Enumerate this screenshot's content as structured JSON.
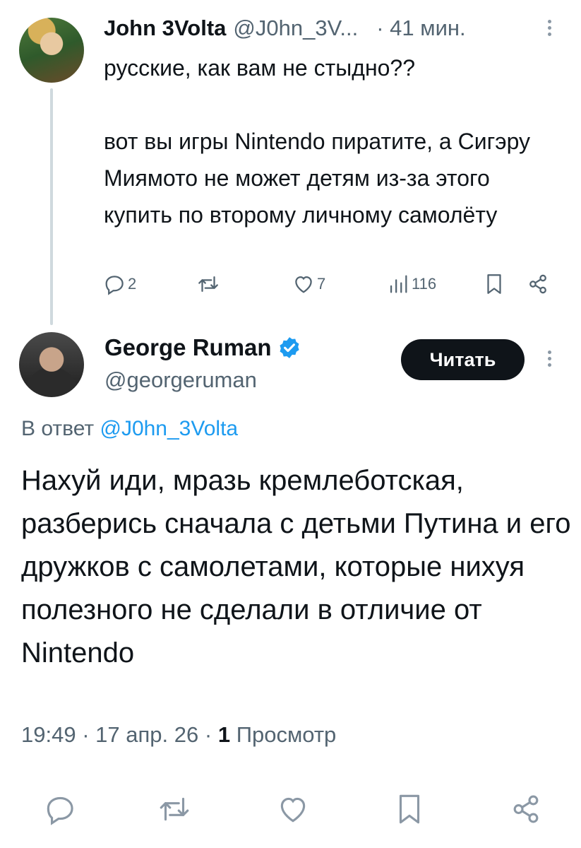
{
  "parent_tweet": {
    "display_name": "John 3Volta",
    "handle": "@J0hn_3V...",
    "time": "· 41 мин.",
    "text": "русские, как вам не стыдно??\n\nвот вы игры Nintendo пиратите, а Сигэру Миямото не может детям из-за этого купить по второму личному самолёту",
    "stats": {
      "replies": "2",
      "retweets": "",
      "likes": "7",
      "views": "116"
    }
  },
  "main_tweet": {
    "display_name": "George Ruman",
    "handle": "@georgeruman",
    "follow_label": "Читать",
    "reply_prefix": "В ответ",
    "reply_to": "@J0hn_3Volta",
    "text": "Нахуй иди, мразь кремлеботская, разберись сначала с детьми Путина и его дружков с самолетами, которые нихуя полезного не сделали в отличие от Nintendo",
    "time": "19:49",
    "date": "17 апр. 26",
    "views_count": "1",
    "views_label": "Просмотр"
  },
  "colors": {
    "text": "#0f1419",
    "secondary": "#536471",
    "link": "#1d9bf0",
    "verified": "#1d9bf0",
    "button": "#0f1419"
  },
  "icons": [
    "reply-icon",
    "retweet-icon",
    "like-icon",
    "views-icon",
    "bookmark-icon",
    "share-icon",
    "verified-icon",
    "more-icon"
  ]
}
